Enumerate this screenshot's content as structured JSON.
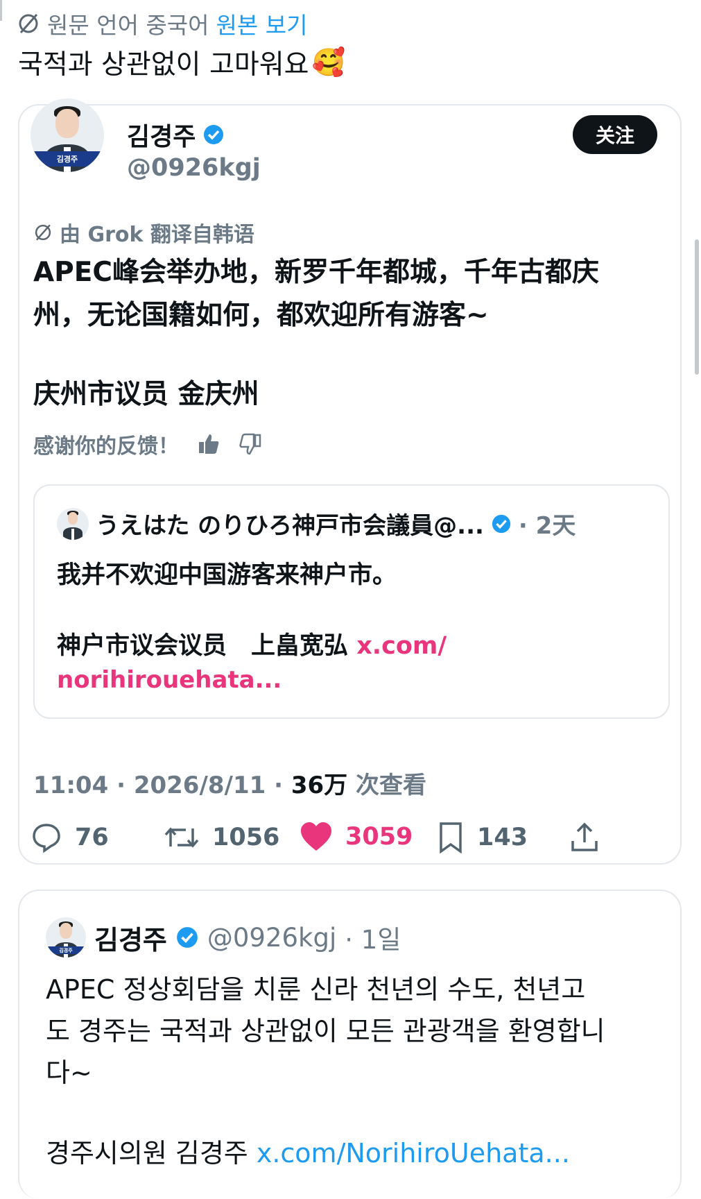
{
  "top": {
    "translate_note": "원문 언어 중국어",
    "view_original": "원본 보기",
    "tweet_text": "국적과 상관없이 고마워요",
    "emoji": "🥰"
  },
  "card": {
    "author_name": "김경주",
    "author_handle": "@0926kgj",
    "avatar_banner": "김경주",
    "follow_label": "关注",
    "grok_note": "由 Grok 翻译自韩语",
    "translation_line1": "APEC峰会举办地，新罗千年都城，千年古都庆",
    "translation_line2": "州，无论国籍如何，都欢迎所有游客~",
    "translation_line3": "庆州市议员 金庆州",
    "feedback_text": "感谢你的反馈！",
    "quote": {
      "author": "うえはた のりひろ神戸市会議員@...",
      "age": "· 2天",
      "line1": "我并不欢迎中国游客来神户市。",
      "line2": "神户市议会议员　上畠宽弘",
      "link1": "x.com/",
      "link2": "norihirouehata..."
    },
    "meta": {
      "time": "11:04 · 2026/8/11 · ",
      "views": "36万",
      "views_label": " 次查看"
    },
    "stats": {
      "replies": "76",
      "retweets": "1056",
      "likes": "3059",
      "bookmarks": "143"
    },
    "colors": {
      "like": "#e8357c",
      "verified": "#1d9bf0",
      "link": "#1d9bf0"
    }
  },
  "card2": {
    "author_name": "김경주",
    "author_handle": "@0926kgj",
    "age": "· 1일",
    "line1": "APEC 정상회담을 치룬 신라 천년의 수도, 천년고",
    "line2": "도 경주는 국적과 상관없이 모든 관광객을 환영합니",
    "line3": "다~",
    "line4": "경주시의원 김경주 ",
    "link": "x.com/NorihiroUehata..."
  }
}
